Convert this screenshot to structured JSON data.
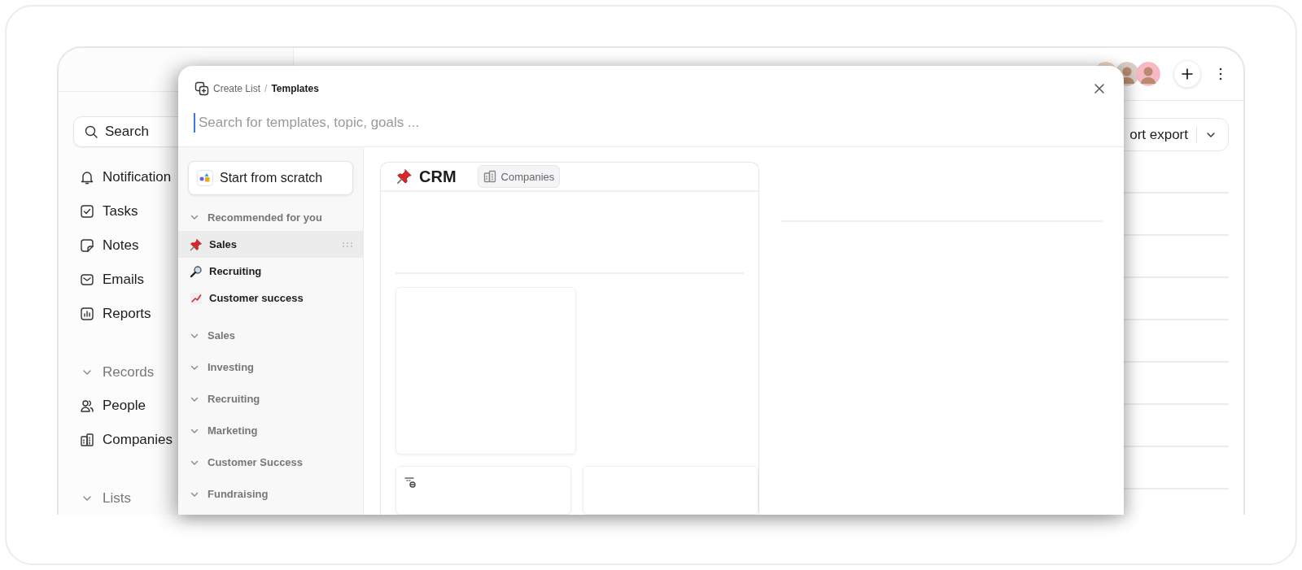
{
  "app": {
    "sidebar": {
      "search": {
        "placeholder": "Search"
      },
      "items": [
        {
          "kind": "bell",
          "label": "Notification"
        },
        {
          "kind": "tasks",
          "label": "Tasks"
        },
        {
          "kind": "note",
          "label": "Notes"
        },
        {
          "kind": "mail",
          "label": "Emails"
        },
        {
          "kind": "reports",
          "label": "Reports"
        },
        {
          "kind": "section",
          "label": "Records"
        },
        {
          "kind": "people",
          "label": "People"
        },
        {
          "kind": "companies",
          "label": "Companies"
        },
        {
          "kind": "section",
          "label": "Lists"
        }
      ]
    },
    "toolbar": {
      "export_button": "ort export"
    }
  },
  "modal": {
    "breadcrumb": [
      "Create List",
      "Templates"
    ],
    "breadcrumb_separator": "/",
    "search": {
      "placeholder": "Search for templates, topic, goals ..."
    },
    "start_button": "Start from scratch",
    "groups": [
      {
        "label": "Recommended for you",
        "children": [
          {
            "kind": "pin",
            "label": "Sales",
            "selected": true
          },
          {
            "kind": "magnifier",
            "label": "Recruiting",
            "selected": false
          },
          {
            "kind": "chart",
            "label": "Customer success",
            "selected": false
          }
        ]
      },
      {
        "label": "Sales"
      },
      {
        "label": "Investing"
      },
      {
        "label": "Recruiting"
      },
      {
        "label": "Marketing"
      },
      {
        "label": "Customer Success"
      },
      {
        "label": "Fundraising"
      }
    ],
    "preview": {
      "title": "CRM",
      "tag": "Companies"
    }
  }
}
